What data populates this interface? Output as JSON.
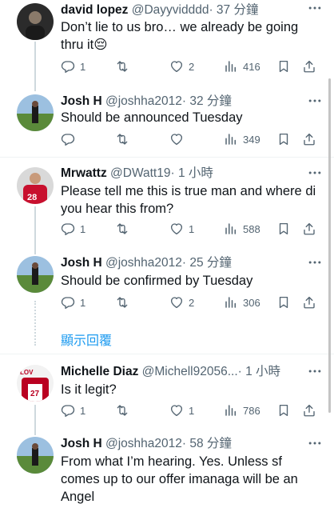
{
  "tweets": [
    {
      "name": "david lopez",
      "handle": "@Dayyvidddd",
      "time": "· 37 分鐘",
      "text": "Don’t lie to us bro… we already be going thru it😔",
      "replies": "1",
      "retweets": "",
      "likes": "2",
      "views": "416"
    },
    {
      "name": "Josh H",
      "handle": "@joshha2012",
      "time": "· 32 分鐘",
      "text": "Should be announced Tuesday",
      "replies": "",
      "retweets": "",
      "likes": "",
      "views": "349"
    },
    {
      "name": "Mrwattz",
      "handle": "@DWatt19",
      "time": "· 1 小時",
      "text": "Please tell me this is true man and where di you hear this from?",
      "replies": "1",
      "retweets": "",
      "likes": "1",
      "views": "588"
    },
    {
      "name": "Josh H",
      "handle": "@joshha2012",
      "time": "· 25 分鐘",
      "text": "Should be confirmed by Tuesday",
      "replies": "1",
      "retweets": "",
      "likes": "2",
      "views": "306"
    },
    {
      "name": "Michelle Diaz",
      "handle": "@Michell92056...",
      "time": "· 1 小時",
      "text": "Is it legit?",
      "replies": "1",
      "retweets": "",
      "likes": "1",
      "views": "786"
    },
    {
      "name": "Josh H",
      "handle": "@joshha2012",
      "time": "· 58 分鐘",
      "text": "From what I’m hearing. Yes. Unless sf comes up to our offer imanaga will be an Angel",
      "replies": "",
      "retweets": "",
      "likes": "",
      "views": ""
    }
  ],
  "show_replies_label": "顯示回覆",
  "icons": {
    "more": "more-icon",
    "reply": "reply-icon",
    "retweet": "retweet-icon",
    "like": "like-icon",
    "views": "views-icon",
    "bookmark": "bookmark-icon",
    "share": "share-icon"
  },
  "colors": {
    "link": "#1d9bf0",
    "secondary_text": "#536471",
    "thread_line": "#cfd9de"
  }
}
